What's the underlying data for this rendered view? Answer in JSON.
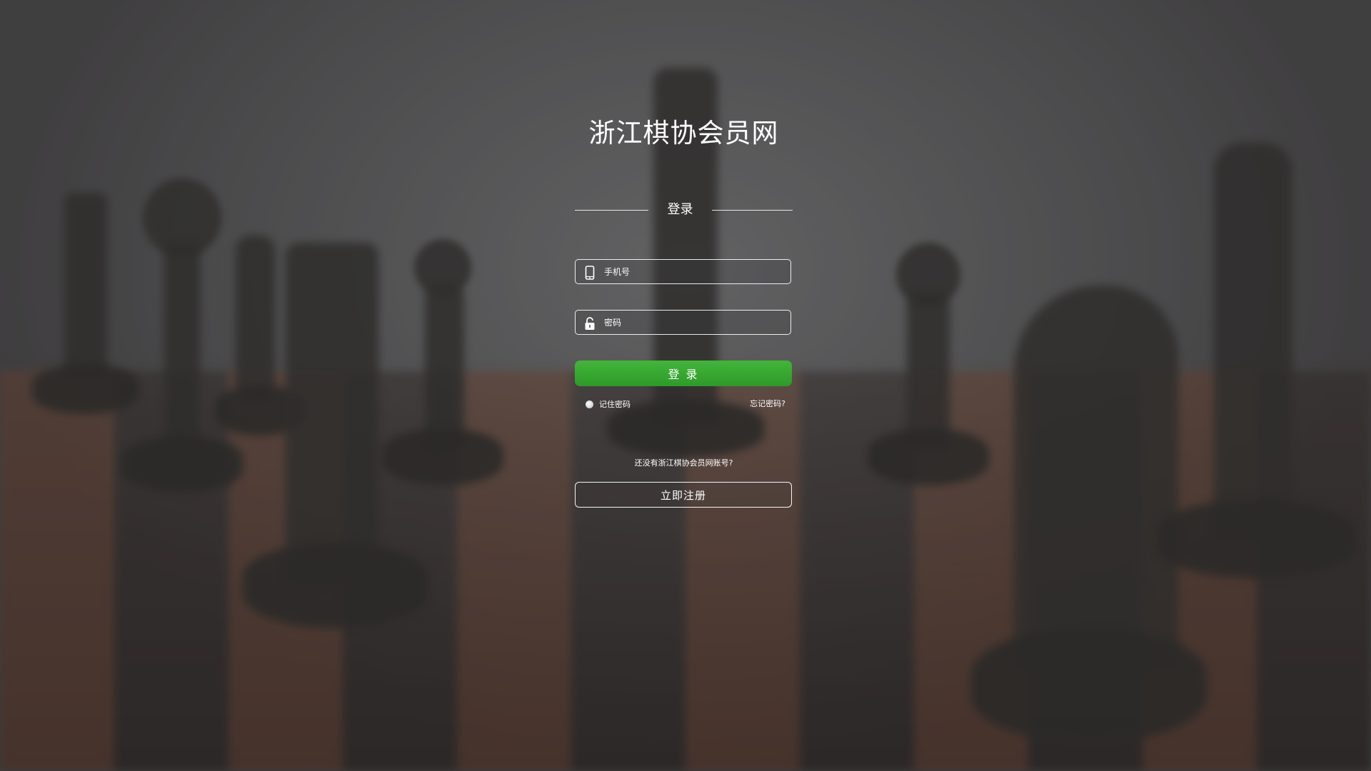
{
  "site": {
    "title": "浙江棋协会员网"
  },
  "login": {
    "section_title": "登录",
    "phone_placeholder": "手机号",
    "password_placeholder": "密码",
    "submit_label": "登 录",
    "remember_label": "记住密码",
    "forgot_label": "忘记密码?",
    "no_account_text": "还没有浙江棋协会员网账号?",
    "register_label": "立即注册"
  },
  "icons": {
    "phone": "phone-icon",
    "lock": "lock-icon"
  },
  "colors": {
    "primary_green": "#3aa935",
    "text": "#ffffff",
    "background": "#5f5f61"
  }
}
